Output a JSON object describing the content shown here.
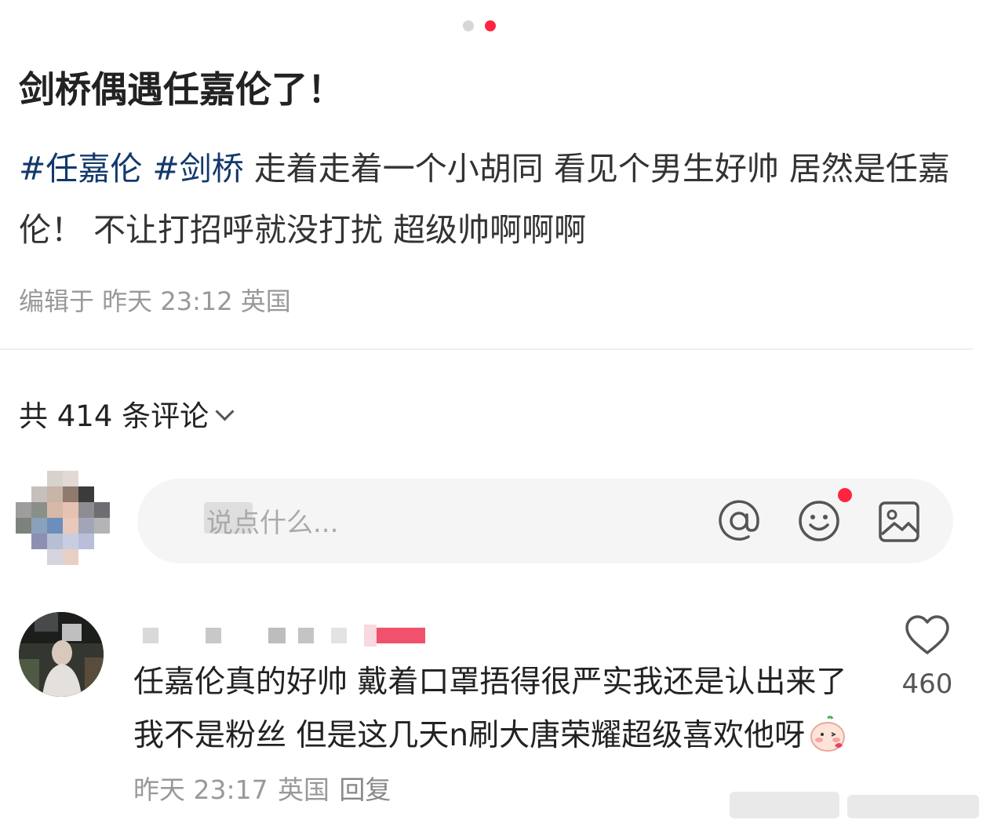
{
  "post": {
    "title": "剑桥偶遇任嘉伦了！",
    "tags": [
      "#任嘉伦",
      "#剑桥"
    ],
    "body": "走着走着一个小胡同 看见个男生好帅 居然是任嘉伦！ 不让打招呼就没打扰 超级帅啊啊啊",
    "meta": "编辑于 昨天 23:12 英国",
    "carousel_pages": 2,
    "carousel_active": 2
  },
  "comments_header": {
    "label": "共 414 条评论"
  },
  "comment_input": {
    "placeholder": "说点什么..."
  },
  "comments": [
    {
      "text": "任嘉伦真的好帅 戴着口罩捂得很严实我还是认出来了 我不是粉丝 但是这几天n刷大唐荣耀超级喜欢他呀",
      "time": "昨天 23:17",
      "location": "英国",
      "reply_label": "回复",
      "likes": "460"
    }
  ],
  "colors": {
    "accent": "#ff2442",
    "tag": "#13386c",
    "meta": "#999999"
  }
}
